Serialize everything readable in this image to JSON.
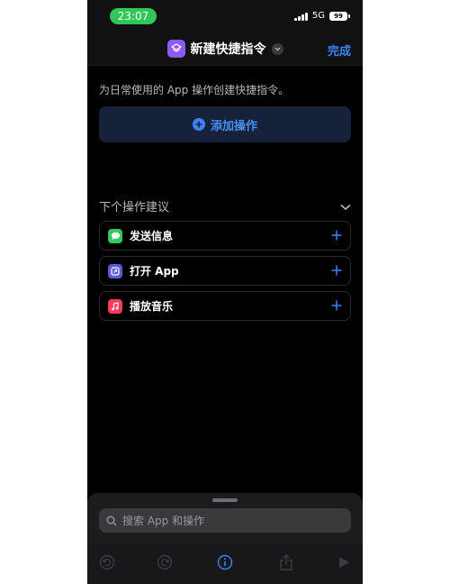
{
  "status_bar": {
    "time": "23:07",
    "network": "5G",
    "battery": "99"
  },
  "nav": {
    "title": "新建快捷指令",
    "done_label": "完成"
  },
  "main": {
    "description": "为日常使用的 App 操作创建快捷指令。",
    "add_action_label": "添加操作"
  },
  "suggestions": {
    "header": "下个操作建议",
    "items": [
      {
        "label": "发送信息",
        "icon": "messages-icon",
        "color": "#34c759"
      },
      {
        "label": "打开 App",
        "icon": "open-app-icon",
        "color": "#5a5ad6"
      },
      {
        "label": "播放音乐",
        "icon": "music-icon",
        "color": "#fa3c5a"
      }
    ]
  },
  "search": {
    "placeholder": "搜索 App 和操作"
  },
  "toolbar": {
    "icons": [
      "undo-icon",
      "redo-icon",
      "info-icon",
      "share-icon",
      "play-icon"
    ]
  },
  "colors": {
    "accent": "#3b82f6",
    "background": "#000000",
    "nav_background": "#111111"
  }
}
